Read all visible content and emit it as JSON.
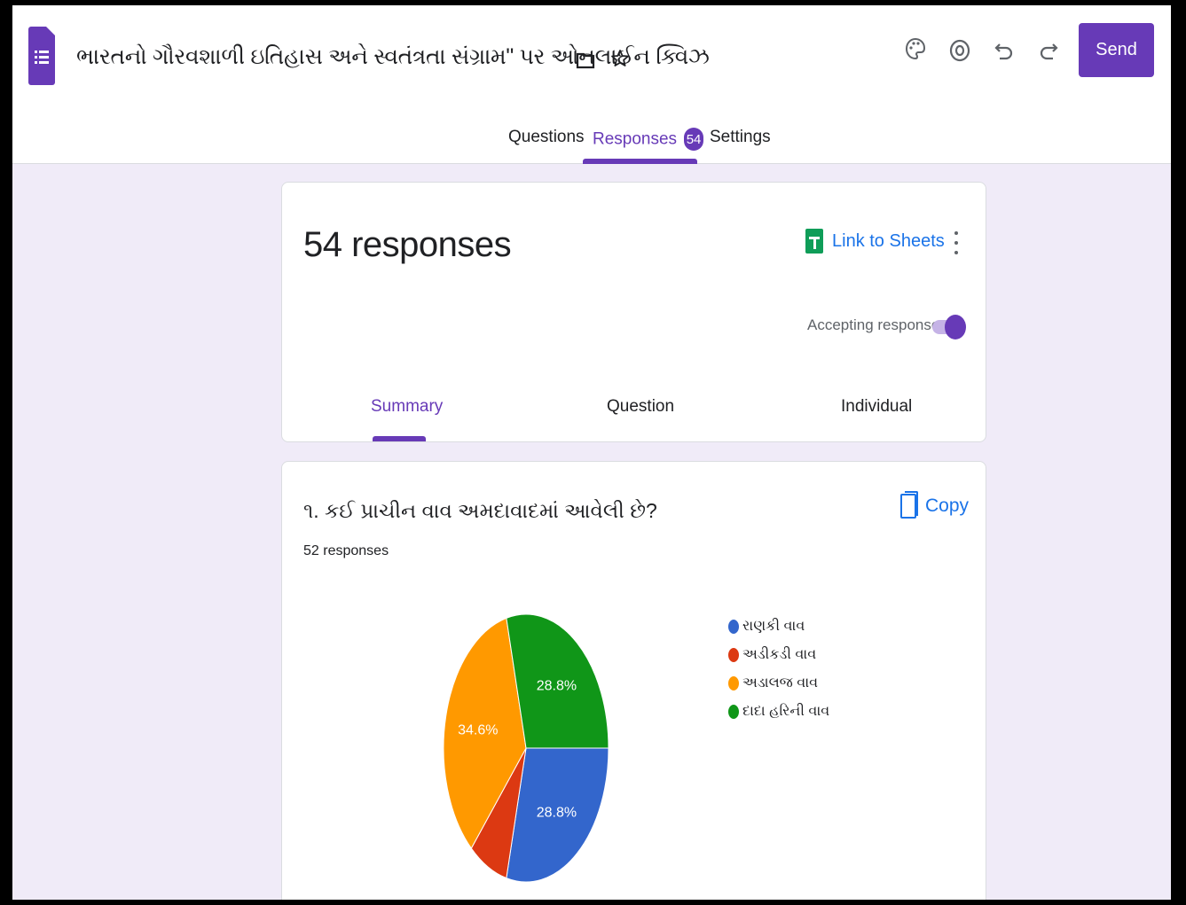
{
  "form": {
    "title": "ભારતનો ગૌરવશાળી ઇતિહાસ અને સ્વતંત્રતા સંગ્રામ\" પર ઓનલાઈન ક્વિઝ",
    "send_label": "Send"
  },
  "icons": {
    "folder": "folder-icon",
    "star": "star-icon",
    "palette": "palette-icon",
    "preview": "eye-icon",
    "undo": "undo-icon",
    "redo": "redo-icon"
  },
  "tabs": {
    "questions": "Questions",
    "responses": "Responses",
    "responses_count": "54",
    "settings": "Settings"
  },
  "summary": {
    "title": "54 responses",
    "link_to_sheets": "Link to Sheets",
    "accepting_label": "Accepting responses",
    "accepting_on": true,
    "subtabs": {
      "summary": "Summary",
      "question": "Question",
      "individual": "Individual"
    }
  },
  "question1": {
    "title": "૧. કઈ પ્રાચીન વાવ અમદાવાદમાં આવેલી છે?",
    "response_count": "52 responses",
    "copy_label": "Copy"
  },
  "chart_data": {
    "type": "pie",
    "categories": [
      "રાણકી વાવ",
      "અડીકડી વાવ",
      "અડાલજ વાવ",
      "દાદા હરિની વાવ"
    ],
    "values": [
      28.8,
      7.7,
      34.6,
      28.8
    ],
    "data_labels": [
      "28.8%",
      "",
      "34.6%",
      "28.8%"
    ],
    "colors": [
      "#3366cc",
      "#dc3912",
      "#ff9900",
      "#109618"
    ],
    "legend_position": "right"
  },
  "colors": {
    "accent": "#673ab7",
    "link": "#1a73e8",
    "background": "#f0ebf8"
  }
}
